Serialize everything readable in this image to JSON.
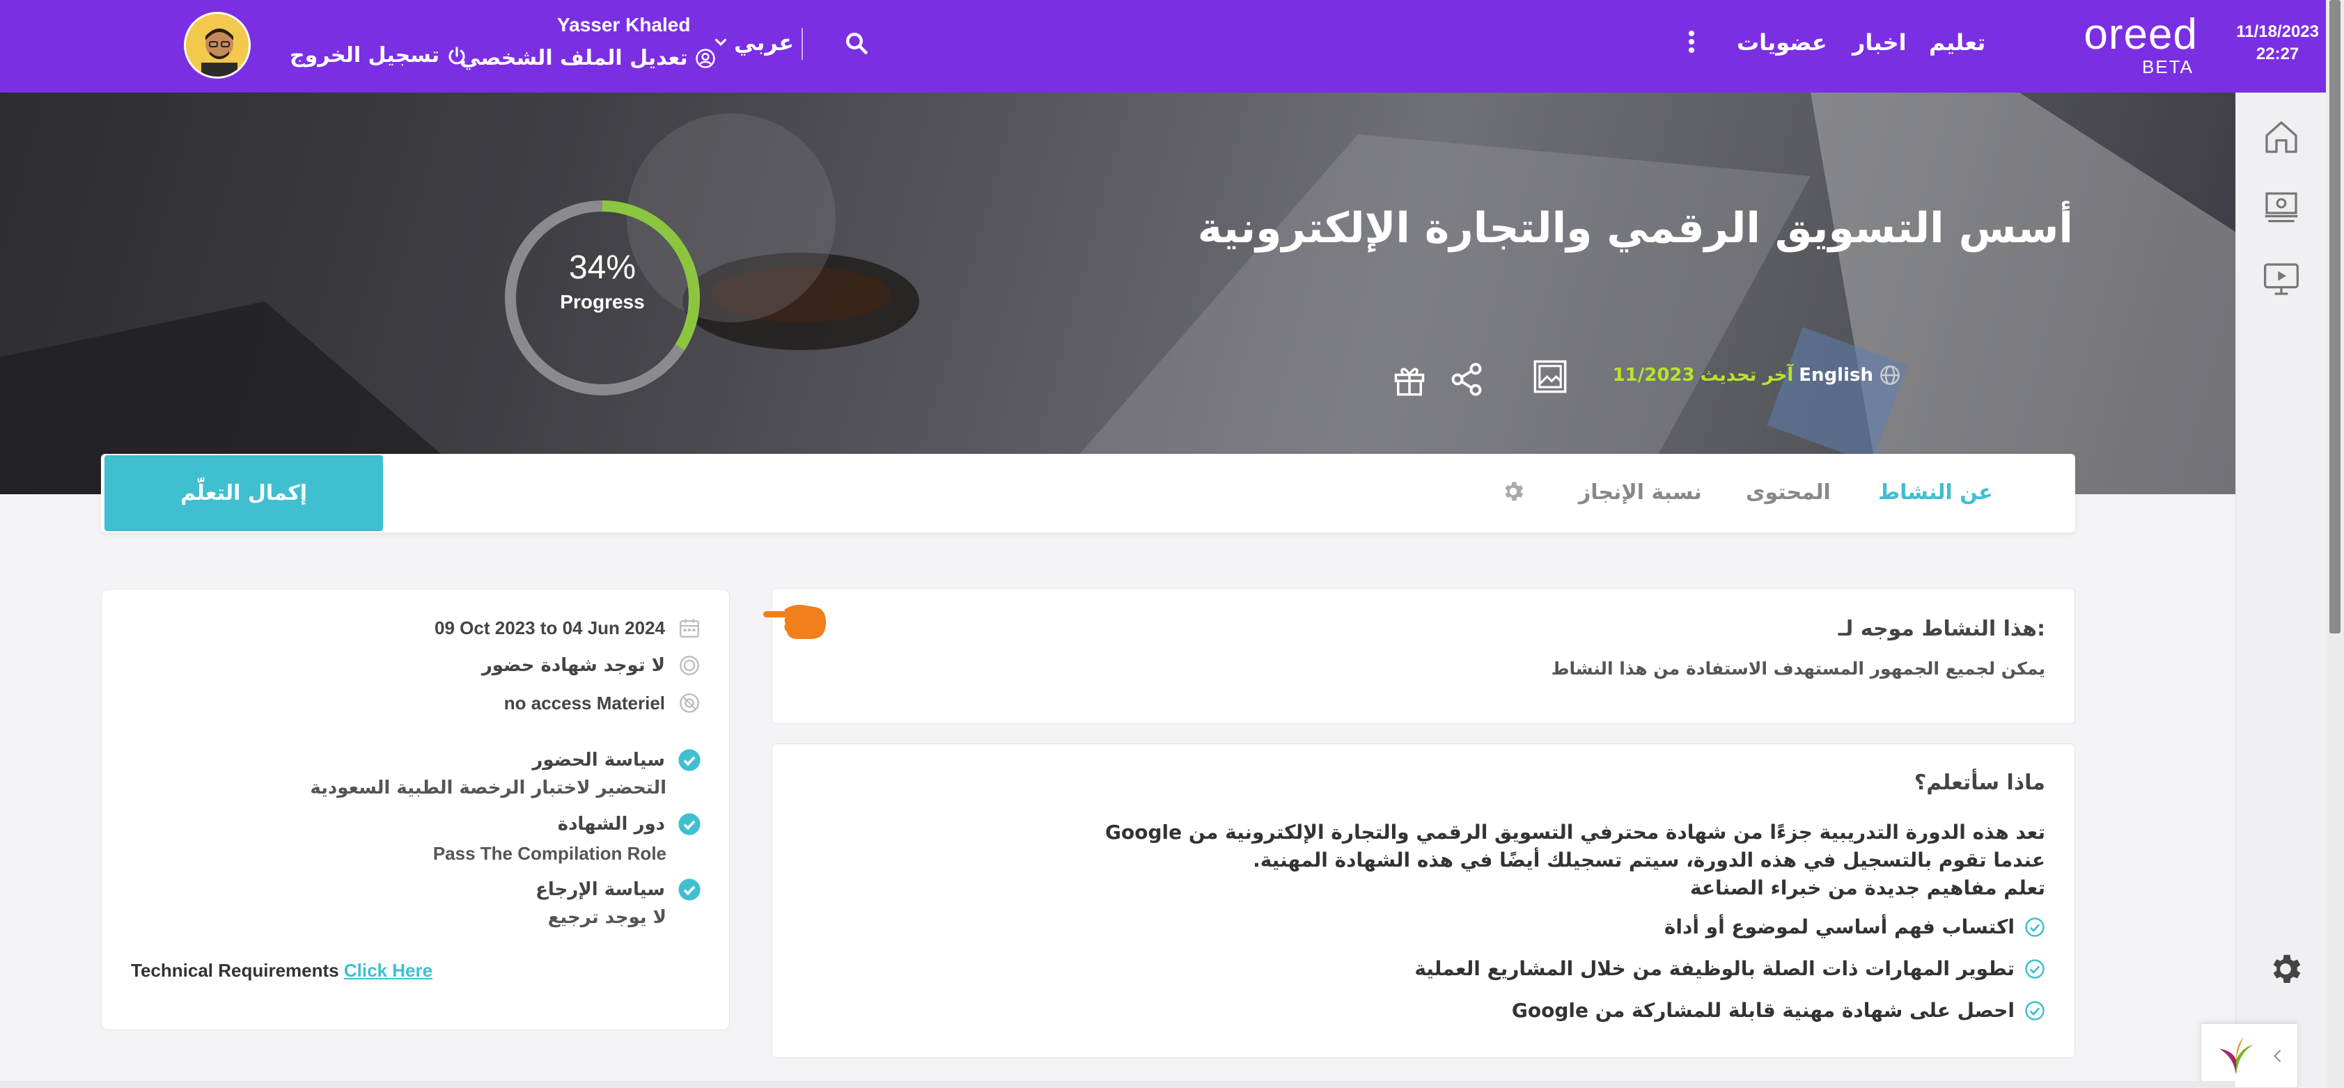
{
  "topbar": {
    "date": "11/18/2023",
    "time": "22:27",
    "logo_text": "oreed",
    "logo_badge": "BETA",
    "nav": [
      "تعليم",
      "اخبار",
      "عضويات"
    ],
    "language": "عربي",
    "user_name": "Yasser Khaled",
    "edit_profile": "تعديل الملف الشخصي",
    "logout": "تسجيل الخروج",
    "icons": [
      "more-vertical-icon",
      "search-icon",
      "user-circle-icon",
      "power-icon",
      "chevron-down-icon"
    ]
  },
  "course": {
    "title": "أسس التسويق الرقمي والتجارة الإلكترونية",
    "language": "English",
    "last_updated_label": "آخر تحديث",
    "last_updated": "11/2023",
    "progress": {
      "value": 34,
      "text": "34%",
      "label": "Progress",
      "color": "#8cc63f"
    }
  },
  "tabs": {
    "items": [
      "عن النشاط",
      "المحتوى",
      "نسبة الإنجاز"
    ],
    "active": "عن النشاط",
    "complete_button": "إكمال التعلّم"
  },
  "audience": {
    "heading": "هذا النشاط موجه لـ:",
    "text": "يمكن لجميع الجمهور المستهدف الاستفادة من هذا النشاط"
  },
  "learn": {
    "heading": "ماذا سأتعلم؟",
    "paragraph": [
      "تعد هذه الدورة التدريبية جزءًا من شهادة محترفي التسويق الرقمي والتجارة الإلكترونية من Google",
      "عندما تقوم بالتسجيل في هذه الدورة، سيتم تسجيلك أيضًا في هذه الشهادة المهنية.",
      "تعلم مفاهيم جديدة من خبراء الصناعة"
    ],
    "bullets": [
      "اكتساب فهم أساسي لموضوع أو أداة",
      "تطوير المهارات ذات الصلة بالوظيفة من خلال المشاريع العملية",
      "احصل على شهادة مهنية قابلة للمشاركة من Google"
    ]
  },
  "info": {
    "dates": "09 Oct 2023 to 04 Jun 2024",
    "attendance_cert": "لا توجد شهادة حضور",
    "materials": "no access Materiel",
    "attendance_policy_label": "سياسة الحضور",
    "attendance_policy": "التحضير لاختبار الرخصة الطبية السعودية",
    "certificate_role_label": "دور الشهادة",
    "certificate_role": "Pass The Compilation Role",
    "refund_policy_label": "سياسة الإرجاع",
    "refund_policy": "لا يوجد ترجيع",
    "tech_req_label": "Technical Requirements",
    "tech_req_link": "Click Here"
  },
  "colors": {
    "topbar": "#7b2fe3",
    "accent": "#3fbfcf",
    "progress": "#8cc63f",
    "updated": "#b8e52a",
    "pointer": "#f07f1c"
  }
}
